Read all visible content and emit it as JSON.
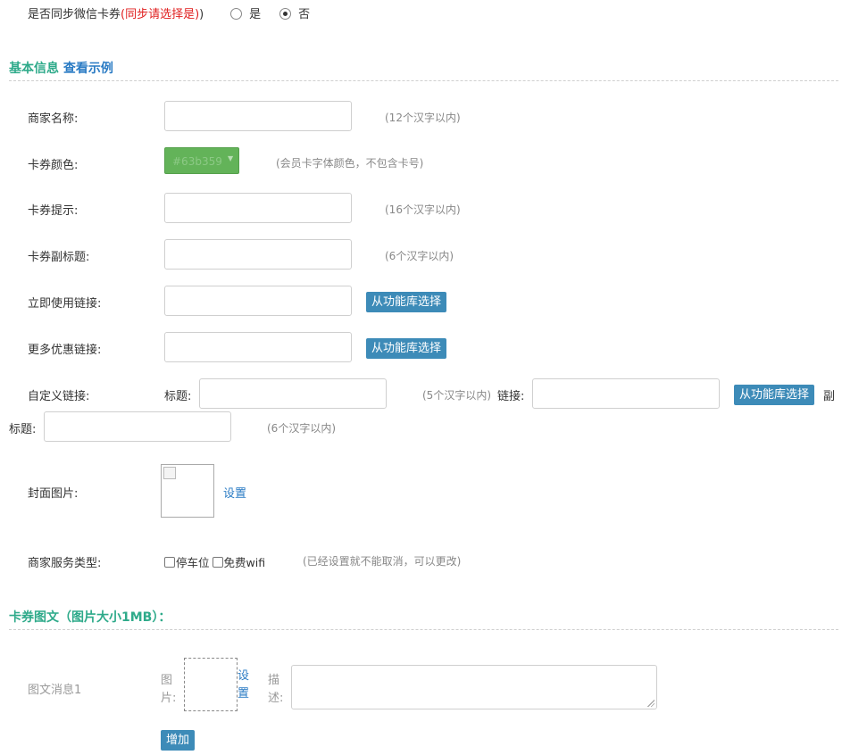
{
  "sync": {
    "label": "是否同步微信卡券",
    "note": "(同步请选择是)",
    "close_paren": ")",
    "option_yes": "是",
    "option_no": "否"
  },
  "basic": {
    "title": "基本信息",
    "example_link": "查看示例"
  },
  "fields": {
    "merchant_name": {
      "label": "商家名称:",
      "hint": "(12个汉字以内)"
    },
    "card_color": {
      "label": "卡券颜色:",
      "value": "#63b359",
      "hint": "(会员卡字体颜色，不包含卡号)",
      "color": "#63b359"
    },
    "card_tip": {
      "label": "卡券提示:",
      "hint": "(16个汉字以内)"
    },
    "card_subtitle": {
      "label": "卡券副标题:",
      "hint": "(6个汉字以内)"
    },
    "use_now_link": {
      "label": "立即使用链接:",
      "button": "从功能库选择"
    },
    "more_offers_link": {
      "label": "更多优惠链接:",
      "button": "从功能库选择"
    },
    "custom_link": {
      "label": "自定义链接:",
      "title_label": "标题:",
      "title_hint": "(5个汉字以内)",
      "link_label": "链接:",
      "button": "从功能库选择",
      "subtitle_label_a": "副",
      "subtitle_label_b": "标题:",
      "subtitle_hint": "(6个汉字以内)"
    },
    "cover_image": {
      "label": "封面图片:",
      "set_link": "设置"
    },
    "service_type": {
      "label": "商家服务类型:",
      "options": [
        "停车位",
        "免费wifi"
      ],
      "hint": "(已经设置就不能取消，可以更改)"
    }
  },
  "graphic": {
    "title": "卡券图文（图片大小1MB）：",
    "item_label": "图文消息1",
    "image_label_a": "图",
    "image_label_b": "片:",
    "set_link_a": "设",
    "set_link_b": "置",
    "desc_label_a": "描",
    "desc_label_b": "述:",
    "add_button": "增加"
  }
}
